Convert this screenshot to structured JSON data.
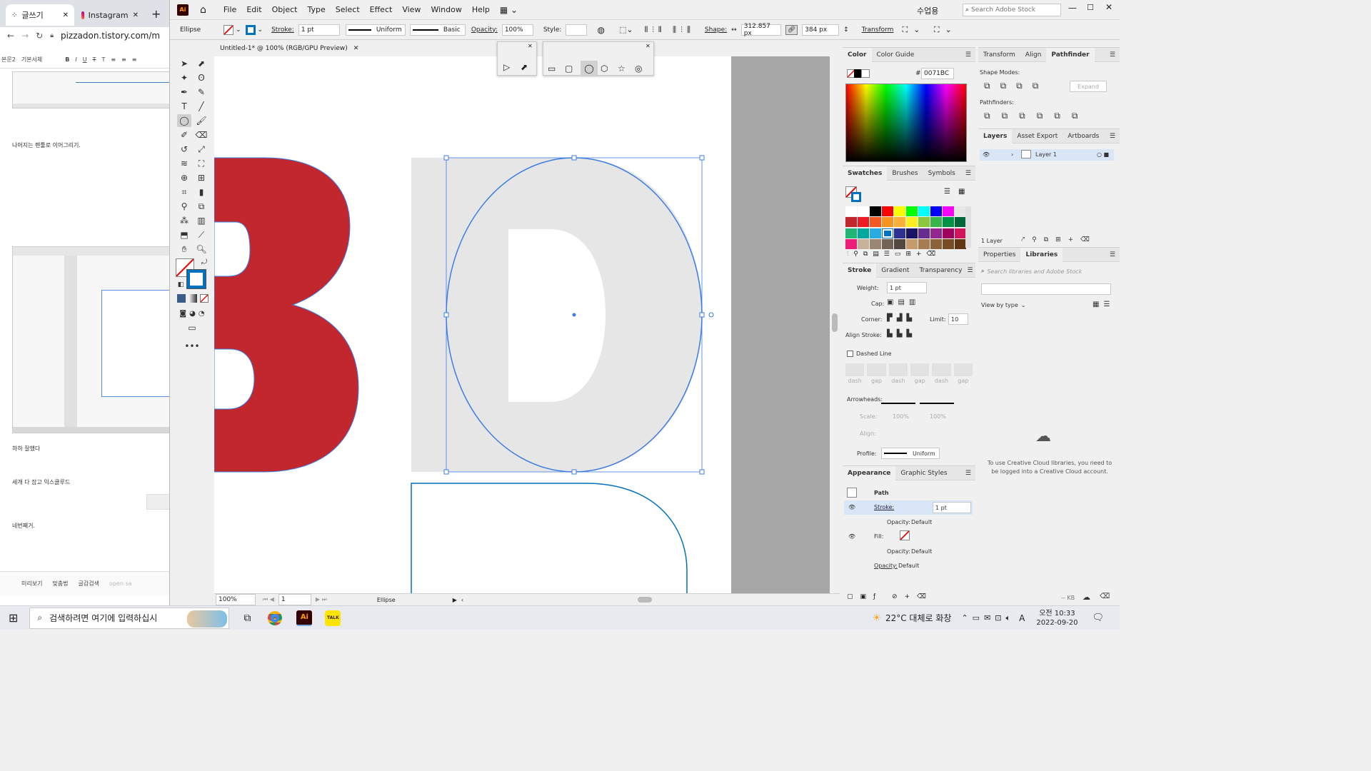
{
  "browser": {
    "tabs": [
      {
        "label": "글쓰기"
      },
      {
        "label": "Instagram"
      }
    ],
    "url": "pizzadon.tistory.com/m",
    "editor_toolbar": {
      "style1": "본문2",
      "style2": "기본서체"
    },
    "texts": [
      "나머지는 펜툴로 이어그리기.",
      "하하 잘했다",
      "세개 다 잡고 익스클루드",
      "네번째거."
    ],
    "footer": [
      "미리보기",
      "맞춤법",
      "글감검색",
      "open sa"
    ]
  },
  "ai": {
    "menu": [
      "File",
      "Edit",
      "Object",
      "Type",
      "Select",
      "Effect",
      "View",
      "Window",
      "Help"
    ],
    "user": "수업용",
    "search_placeholder": "Search Adobe Stock",
    "control": {
      "object": "Ellipse",
      "stroke_label": "Stroke:",
      "stroke_weight": "1 pt",
      "uniform": "Uniform",
      "basic": "Basic",
      "opacity_label": "Opacity:",
      "opacity": "100%",
      "style_label": "Style:",
      "shape_label": "Shape:",
      "width": "312.857 px",
      "height": "384 px",
      "transform": "Transform"
    },
    "doc_tab": "Untitled-1* @ 100% (RGB/GPU Preview)",
    "status": {
      "zoom": "100%",
      "artboard": "1",
      "tool": "Ellipse"
    },
    "color_panel": {
      "tabs": [
        "Color",
        "Color Guide"
      ],
      "hex_prefix": "#",
      "hex": "0071BC"
    },
    "swatches_panel": {
      "tabs": [
        "Swatches",
        "Brushes",
        "Symbols"
      ]
    },
    "stroke_panel": {
      "tabs": [
        "Stroke",
        "Gradient",
        "Transparency"
      ],
      "weight_label": "Weight:",
      "weight": "1 pt",
      "cap_label": "Cap:",
      "corner_label": "Corner:",
      "limit_label": "Limit:",
      "limit": "10",
      "align_label": "Align Stroke:",
      "dashed": "Dashed Line",
      "dash_labels": [
        "dash",
        "gap",
        "dash",
        "gap",
        "dash",
        "gap"
      ],
      "arrowheads": "Arrowheads:",
      "scale": "Scale:",
      "scale1": "100%",
      "scale2": "100%",
      "align2": "Align:",
      "profile": "Profile:",
      "profile_value": "Uniform"
    },
    "appearance_panel": {
      "tabs": [
        "Appearance",
        "Graphic Styles"
      ],
      "path": "Path",
      "stroke": "Stroke:",
      "stroke_value": "1 pt",
      "opacity_label": "Opacity:",
      "opacity_value": "Default",
      "fill": "Fill:",
      "opacity2_label": "Opacity:",
      "opacity2_value": "Default",
      "opacity3_label": "Opacity:",
      "opacity3_value": "Default"
    },
    "transform_panel": {
      "tabs": [
        "Transform",
        "Align",
        "Pathfinder"
      ],
      "shape_modes": "Shape Modes:",
      "expand": "Expand",
      "pathfinders": "Pathfinders:"
    },
    "layers_panel": {
      "tabs": [
        "Layers",
        "Asset Export",
        "Artboards"
      ],
      "layer": "Layer 1",
      "count": "1 Layer"
    },
    "libraries_panel": {
      "tabs": [
        "Properties",
        "Libraries"
      ],
      "search_placeholder": "Search libraries and Adobe Stock",
      "view_by": "View by type",
      "message": "To use Creative Cloud libraries, you need to be logged into a Creative Cloud account.",
      "kb": "-- KB"
    }
  },
  "taskbar": {
    "search_placeholder": "검색하려면 여기에 입력하십시",
    "weather": "22°C 대체로 화창",
    "time": "오전 10:33",
    "date": "2022-09-20",
    "ime": "A",
    "ai_label": "Ai",
    "talk_label": "TALK"
  },
  "colors": {
    "selection": "#3d7de4",
    "red_letter": "#c1272d",
    "fill_gray": "#e6e6e6",
    "stroke_blue": "#0071bc"
  }
}
